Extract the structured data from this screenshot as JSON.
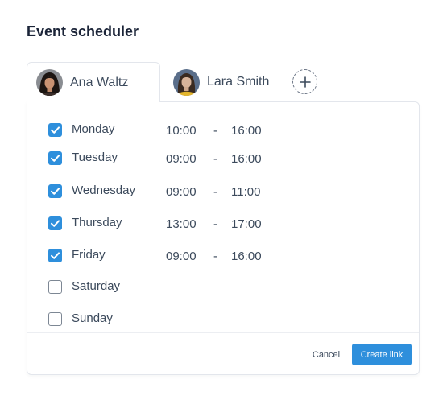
{
  "page": {
    "title": "Event scheduler"
  },
  "tabs": [
    {
      "name": "Ana Waltz",
      "active": true
    },
    {
      "name": "Lara Smith",
      "active": false
    }
  ],
  "add_tab_icon": "plus-icon",
  "schedule": [
    {
      "day": "Monday",
      "checked": true,
      "start": "10:00",
      "separator": "-",
      "end": "16:00"
    },
    {
      "day": "Tuesday",
      "checked": true,
      "start": "09:00",
      "separator": "-",
      "end": "16:00"
    },
    {
      "day": "Wednesday",
      "checked": true,
      "start": "09:00",
      "separator": "-",
      "end": "11:00"
    },
    {
      "day": "Thursday",
      "checked": true,
      "start": "13:00",
      "separator": "-",
      "end": "17:00"
    },
    {
      "day": "Friday",
      "checked": true,
      "start": "09:00",
      "separator": "-",
      "end": "16:00"
    },
    {
      "day": "Saturday",
      "checked": false,
      "start": "",
      "separator": "",
      "end": ""
    },
    {
      "day": "Sunday",
      "checked": false,
      "start": "",
      "separator": "",
      "end": ""
    }
  ],
  "footer": {
    "cancel_label": "Cancel",
    "create_label": "Create link"
  },
  "colors": {
    "accent": "#2e8fdc",
    "title": "#1b2438",
    "text": "#3c4a5c",
    "border": "#e3e6ec"
  }
}
